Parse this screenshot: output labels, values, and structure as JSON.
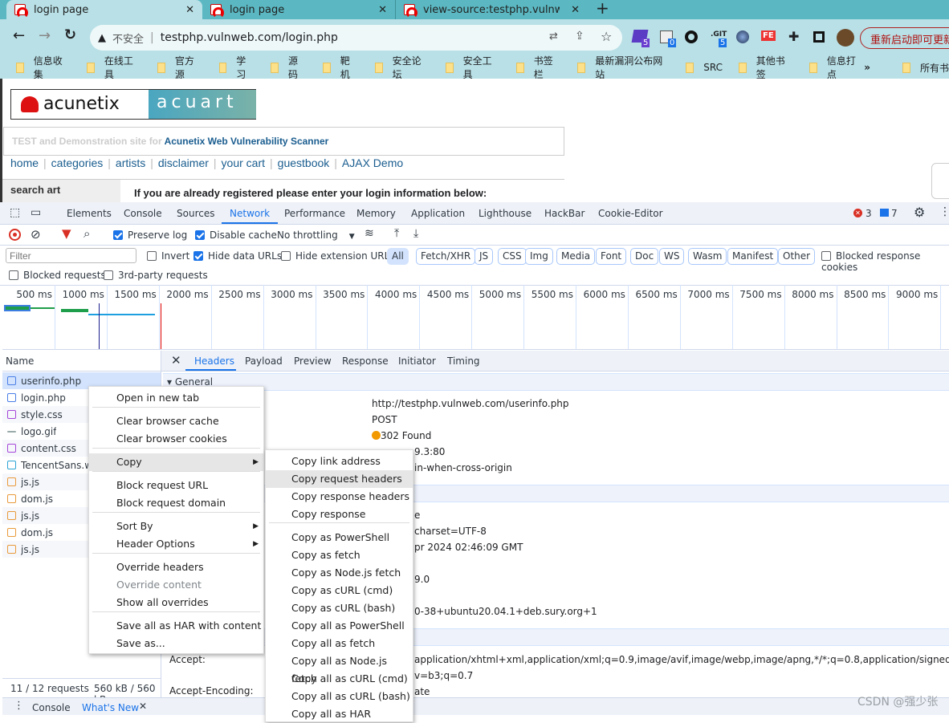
{
  "browser": {
    "tabs": [
      {
        "title": "login page",
        "active": true
      },
      {
        "title": "login page",
        "active": false
      },
      {
        "title": "view-source:testphp.vulnweb.c",
        "active": false
      }
    ],
    "new_tab": "+",
    "security_label": "不安全",
    "url": "testphp.vulnweb.com/login.php",
    "extension_badges": [
      "5",
      "0",
      "5"
    ],
    "git_label": ".GIT",
    "fe_label": "FE",
    "restart_label": "重新启动即可更新",
    "bookmarks": [
      "信息收集",
      "在线工具",
      "官方源",
      "学习",
      "源码",
      "靶机",
      "安全论坛",
      "安全工具",
      "书签栏",
      "最新漏洞公布网站",
      "SRC",
      "其他书签",
      "信息打点"
    ],
    "more": "»",
    "all_bookmarks": "所有书"
  },
  "site": {
    "logo_text": "acunetix",
    "banner_text": "acuart",
    "tagline_prefix": "TEST and Demonstration site for",
    "tagline_link": "Acunetix Web Vulnerability Scanner",
    "nav": [
      "home",
      "categories",
      "artists",
      "disclaimer",
      "your cart",
      "guestbook",
      "AJAX Demo"
    ],
    "search_label": "search art",
    "login_prompt": "If you are already registered please enter your login information below:"
  },
  "devtools": {
    "tabs": [
      "Elements",
      "Console",
      "Sources",
      "Network",
      "Performance",
      "Memory",
      "Application",
      "Lighthouse",
      "HackBar",
      "Cookie-Editor"
    ],
    "active_tab": "Network",
    "errors": "3",
    "messages": "7",
    "toolbar": {
      "preserve_log": "Preserve log",
      "preserve_log_checked": true,
      "disable_cache": "Disable cache",
      "disable_cache_checked": true,
      "throttling": "No throttling"
    },
    "filter": {
      "placeholder": "Filter",
      "invert": "Invert",
      "hide_data_urls": "Hide data URLs",
      "hide_extension_urls": "Hide extension URLs",
      "blocked_response_cookies": "Blocked response cookies",
      "blocked_requests": "Blocked requests",
      "third_party": "3rd-party requests"
    },
    "type_filters": [
      "All",
      "Fetch/XHR",
      "JS",
      "CSS",
      "Img",
      "Media",
      "Font",
      "Doc",
      "WS",
      "Wasm",
      "Manifest",
      "Other"
    ],
    "timeline_ticks": [
      "500 ms",
      "1000 ms",
      "1500 ms",
      "2000 ms",
      "2500 ms",
      "3000 ms",
      "3500 ms",
      "4000 ms",
      "4500 ms",
      "5000 ms",
      "5500 ms",
      "6000 ms",
      "6500 ms",
      "7000 ms",
      "7500 ms",
      "8000 ms",
      "8500 ms",
      "9000 ms"
    ],
    "name_header": "Name",
    "files": [
      {
        "name": "userinfo.php",
        "type": "doc"
      },
      {
        "name": "login.php",
        "type": "doc"
      },
      {
        "name": "style.css",
        "type": "css"
      },
      {
        "name": "logo.gif",
        "type": "img"
      },
      {
        "name": "content.css",
        "type": "css"
      },
      {
        "name": "TencentSans.wo",
        "type": "font"
      },
      {
        "name": "js.js",
        "type": "js"
      },
      {
        "name": "dom.js",
        "type": "js"
      },
      {
        "name": "js.js",
        "type": "js"
      },
      {
        "name": "dom.js",
        "type": "js"
      },
      {
        "name": "js.js",
        "type": "js"
      }
    ],
    "status": {
      "requests": "11 / 12 requests",
      "transferred": "560 kB / 560 kB"
    },
    "detail_tabs": [
      "Headers",
      "Payload",
      "Preview",
      "Response",
      "Initiator",
      "Timing"
    ],
    "general_label": "General",
    "general_values": [
      "http://testphp.vulnweb.com/userinfo.php",
      "POST",
      "302 Found",
      "9.3:80",
      "in-when-cross-origin"
    ],
    "response_fragments": [
      "e",
      "charset=UTF-8",
      "pr 2024 02:46:09 GMT",
      "9.0",
      "0-38+ubuntu20.04.1+deb.sury.org+1"
    ],
    "request_labels": [
      "Accept:",
      "Accept-Encoding:"
    ],
    "request_fragments": [
      "application/xhtml+xml,application/xml;q=0.9,image/avif,image/webp,image/apng,*/*;q=0.8,application/signed-",
      "v=b3;q=0.7",
      "ate"
    ],
    "drawer": {
      "console": "Console",
      "whats_new": "What's New"
    }
  },
  "context_menu": {
    "items": [
      "Open in new tab",
      "Clear browser cache",
      "Clear browser cookies",
      "Copy",
      "Block request URL",
      "Block request domain",
      "Sort By",
      "Header Options",
      "Override headers",
      "Override content",
      "Show all overrides",
      "Save all as HAR with content",
      "Save as..."
    ],
    "copy_submenu": [
      "Copy link address",
      "Copy request headers",
      "Copy response headers",
      "Copy response",
      "Copy as PowerShell",
      "Copy as fetch",
      "Copy as Node.js fetch",
      "Copy as cURL (cmd)",
      "Copy as cURL (bash)",
      "Copy all as PowerShell",
      "Copy all as fetch",
      "Copy all as Node.js fetch",
      "Copy all as cURL (cmd)",
      "Copy all as cURL (bash)",
      "Copy all as HAR"
    ],
    "highlighted": "Copy request headers"
  },
  "watermark": "CSDN @强少张",
  "colors": {
    "accent": "#1a73e8",
    "status_302": "#f29900",
    "error": "#d93025",
    "chrome_teal": "#5bb8c2"
  }
}
